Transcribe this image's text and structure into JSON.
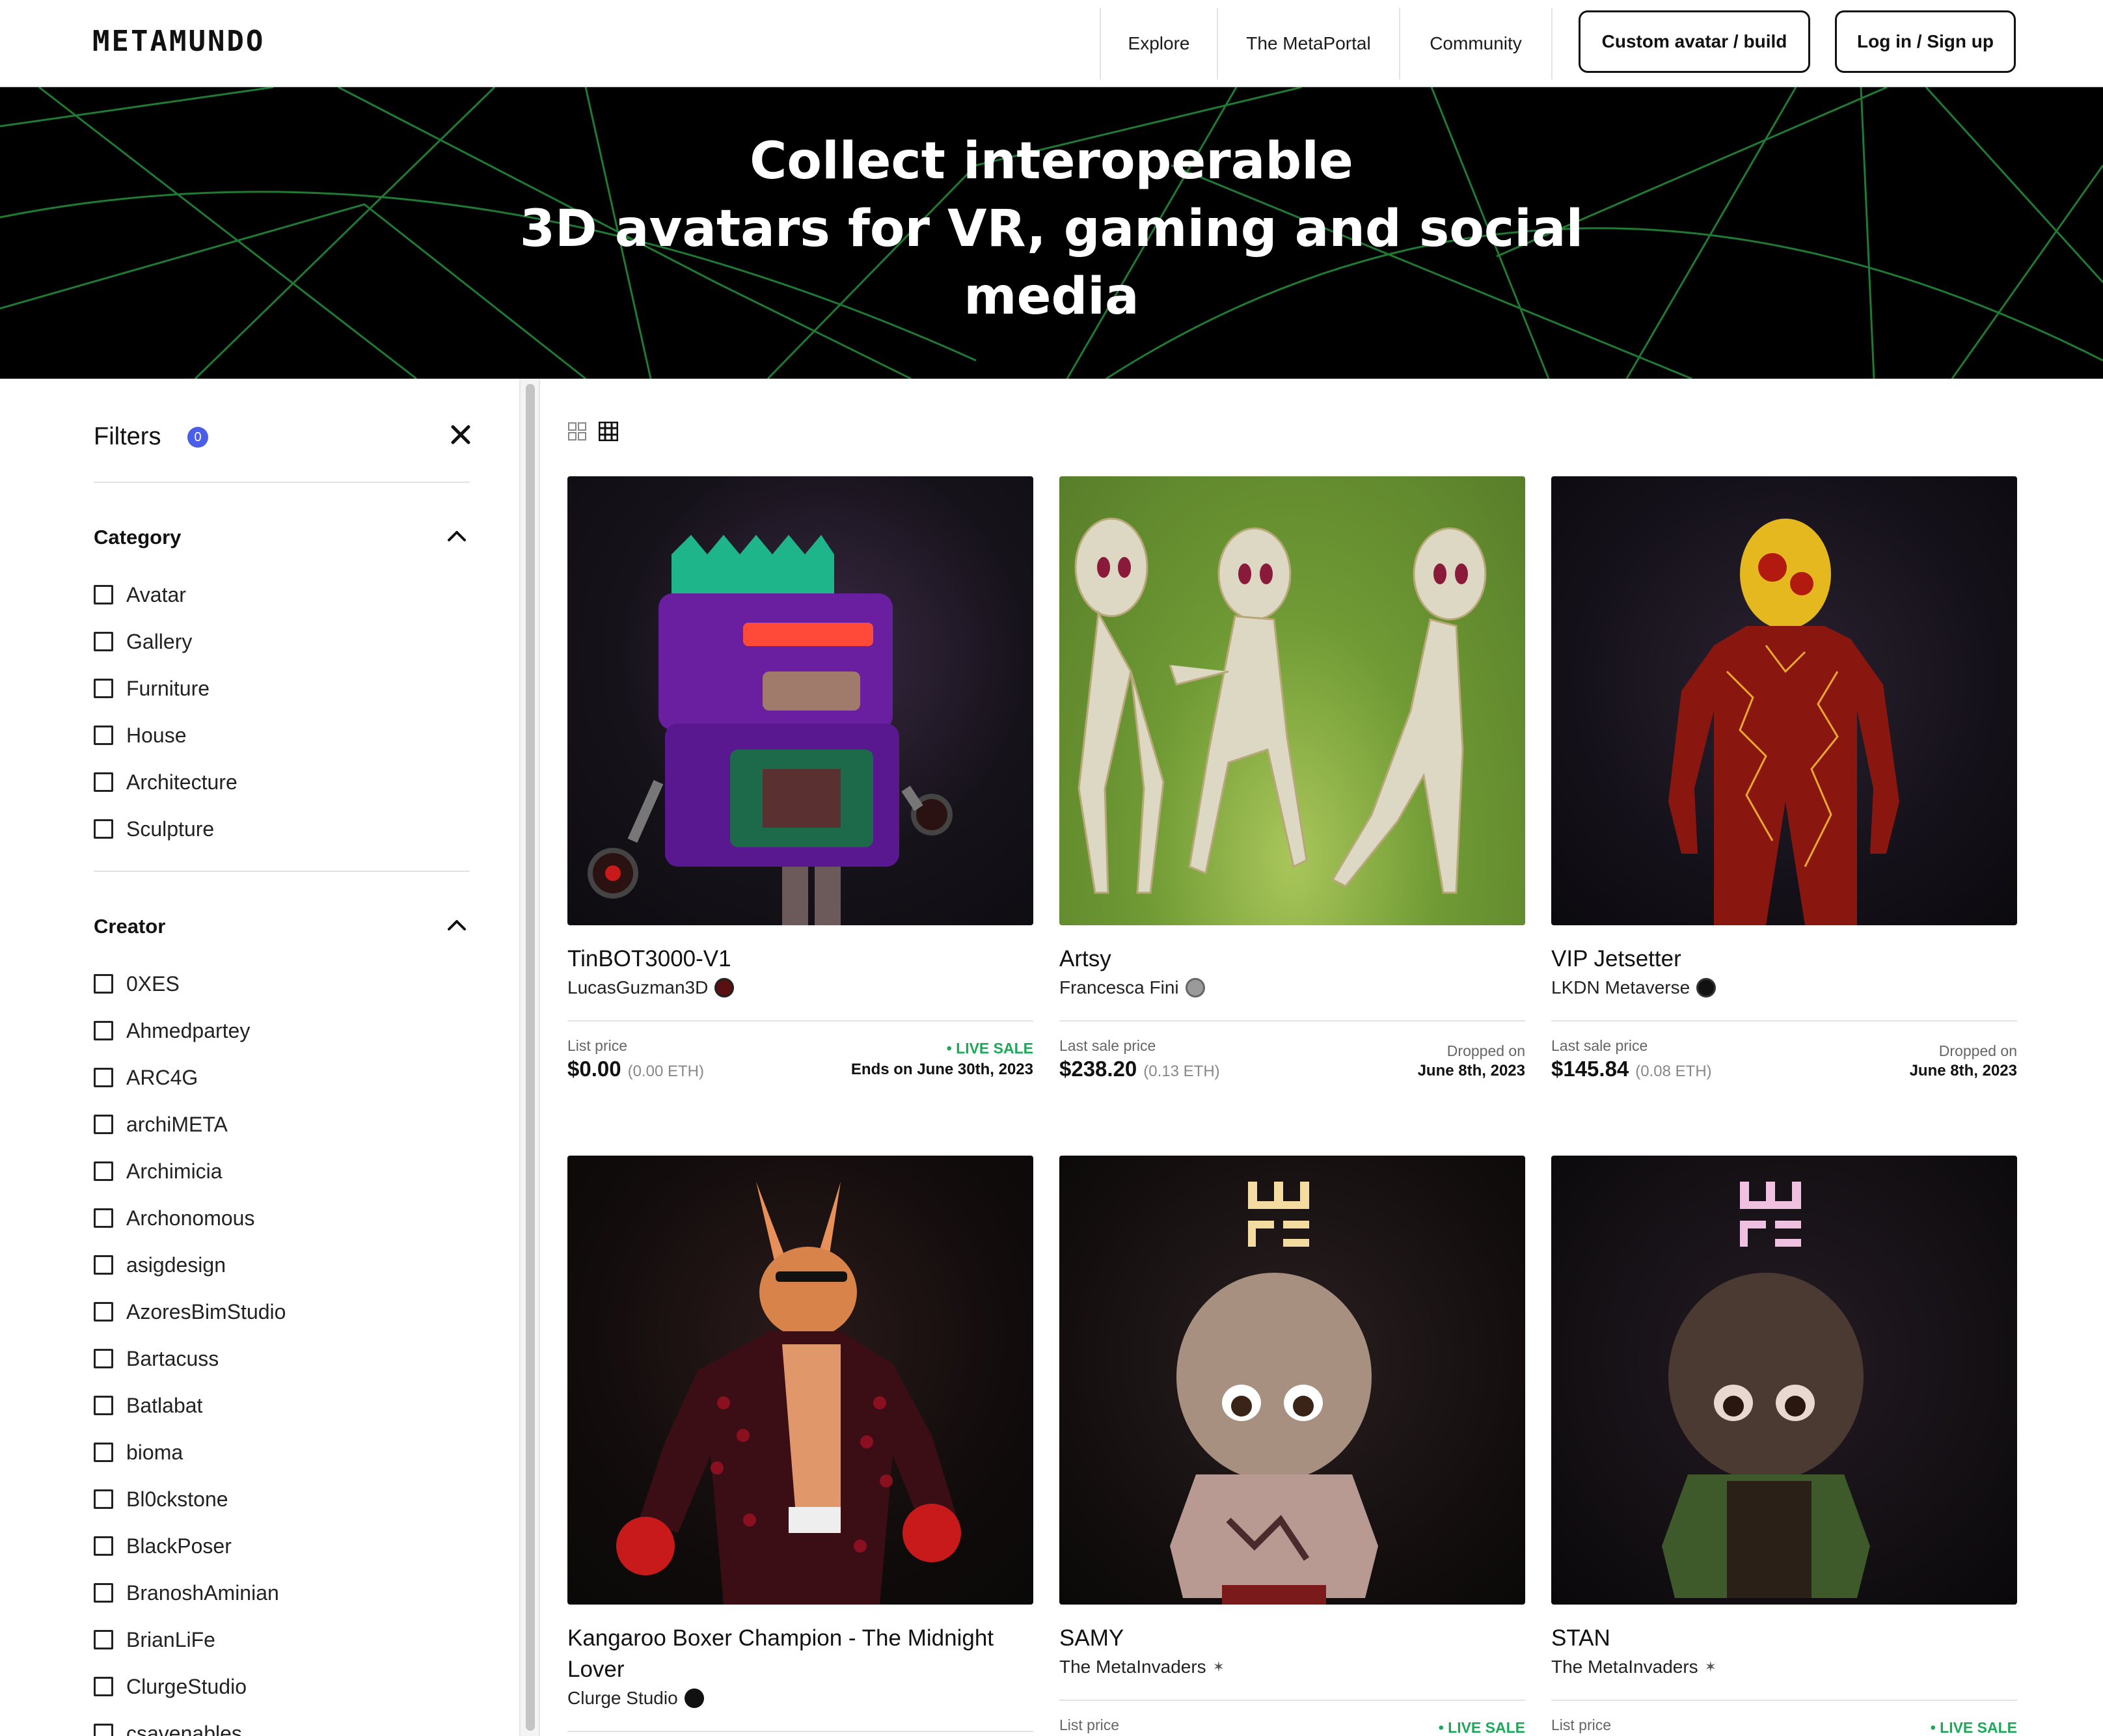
{
  "brand": {
    "logo": "METAMUNDO"
  },
  "nav": {
    "explore": "Explore",
    "metaportal": "The MetaPortal",
    "community": "Community",
    "custom_avatar": "Custom avatar / build",
    "login": "Log in / Sign up"
  },
  "hero": {
    "line1": "Collect interoperable",
    "line2": "3D avatars for VR, gaming and social",
    "line3": "media"
  },
  "filters": {
    "title": "Filters",
    "count": "0",
    "category": {
      "title": "Category",
      "options": [
        "Avatar",
        "Gallery",
        "Furniture",
        "House",
        "Architecture",
        "Sculpture"
      ]
    },
    "creator": {
      "title": "Creator",
      "options": [
        "0XES",
        "Ahmedpartey",
        "ARC4G",
        "archiMETA",
        "Archimicia",
        "Archonomous",
        "asigdesign",
        "AzoresBimStudio",
        "Bartacuss",
        "Batlabat",
        "bioma",
        "Bl0ckstone",
        "BlackPoser",
        "BranoshAminian",
        "BrianLiFe",
        "ClurgeStudio",
        "csavenables"
      ]
    }
  },
  "cards": [
    {
      "title": "TinBOT3000-V1",
      "creator": "LucasGuzman3D",
      "price_label": "List price",
      "price": "$0.00",
      "eth": "(0.00 ETH)",
      "status": "• LIVE SALE",
      "status_detail": "Ends on June 30th, 2023"
    },
    {
      "title": "Artsy",
      "creator": "Francesca Fini",
      "price_label": "Last sale price",
      "price": "$238.20",
      "eth": "(0.13 ETH)",
      "status": "Dropped on",
      "status_detail": "June 8th, 2023"
    },
    {
      "title": "VIP Jetsetter",
      "creator": "LKDN Metaverse",
      "price_label": "Last sale price",
      "price": "$145.84",
      "eth": "(0.08 ETH)",
      "status": "Dropped on",
      "status_detail": "June 8th, 2023"
    },
    {
      "title": "Kangaroo Boxer Champion - The Midnight Lover",
      "creator": "Clurge Studio"
    },
    {
      "title": "SAMY",
      "creator": "The MetaInvaders",
      "price_label": "List price",
      "status": "• LIVE SALE"
    },
    {
      "title": "STAN",
      "creator": "The MetaInvaders",
      "price_label": "List price",
      "status": "• LIVE SALE"
    }
  ],
  "colors": {
    "accent": "#4b5ee8",
    "live": "#1ea95a",
    "hero_bg": "#000000",
    "hero_lines": "#1f7a33"
  }
}
